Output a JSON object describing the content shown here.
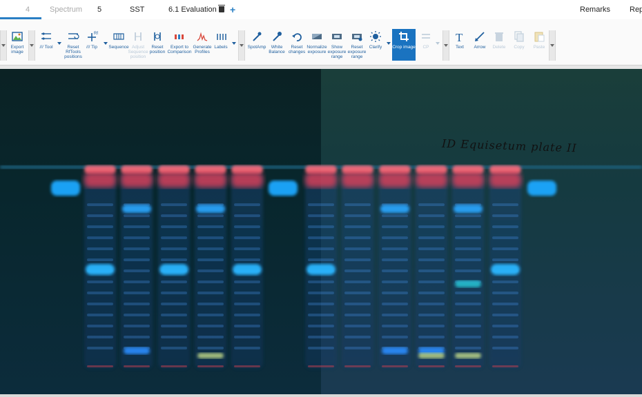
{
  "tabs": [
    {
      "label": "4",
      "dim": true
    },
    {
      "label": "Spectrum",
      "dim": true
    },
    {
      "label": "5",
      "dim": false
    },
    {
      "label": "SST",
      "dim": false
    },
    {
      "label": "6.1 Evaluation",
      "dim": false
    }
  ],
  "add_tab_label": "+",
  "right_tabs": [
    {
      "label": "Remarks"
    },
    {
      "label": "Rep"
    }
  ],
  "toolbar": {
    "export_image": "Export image",
    "tool": "/// Tool",
    "reset_rftools": "Reset RfTools positions",
    "tip": "/// Tip",
    "sequence": "Sequence",
    "adjust_sequence": "Adjust Sequence position",
    "reset_position": "Reset position",
    "export_comparison": "Export to Comparison",
    "generate_profiles": "Generate Profiles",
    "labels": "Labels",
    "spotamp": "SpotAmp",
    "white_balance": "White Balance",
    "reset_changes": "Reset changes",
    "normalize_exposure": "Normalize exposure",
    "show_exposure_range": "Show exposure range",
    "reset_exposure_range": "Reset exposure range",
    "clarify": "Clarify",
    "crop_image": "Crop image",
    "cp": "CP",
    "text": "Text",
    "arrow": "Arrow",
    "delete": "Delete",
    "copy": "Copy",
    "paste": "Paste"
  },
  "plate": {
    "annotation": "ID  Equisetum plate II",
    "colors": {
      "background": "#0a2a2c",
      "red_band": "#ff4a60",
      "blue_band": "#1ea8ff",
      "front_line": "#1d5e7a"
    },
    "tracks": [
      {
        "type": "reference",
        "bands": [
          "blue-top"
        ]
      },
      {
        "type": "sample",
        "bands": [
          "red",
          "blue-mid"
        ]
      },
      {
        "type": "sample",
        "bands": [
          "red",
          "blue-upper",
          "blue-low"
        ]
      },
      {
        "type": "sample",
        "bands": [
          "red",
          "blue-mid"
        ]
      },
      {
        "type": "sample",
        "bands": [
          "red",
          "blue-upper",
          "yellow-low"
        ]
      },
      {
        "type": "sample",
        "bands": [
          "red",
          "blue-mid"
        ]
      },
      {
        "type": "reference",
        "bands": [
          "blue-top"
        ]
      },
      {
        "type": "sample",
        "bands": [
          "red",
          "blue-mid"
        ]
      },
      {
        "type": "sample",
        "bands": [
          "red"
        ]
      },
      {
        "type": "sample",
        "bands": [
          "red",
          "blue-upper",
          "blue-low"
        ]
      },
      {
        "type": "sample",
        "bands": [
          "red",
          "blue-low",
          "yellow-low"
        ]
      },
      {
        "type": "sample",
        "bands": [
          "red",
          "blue-upper",
          "teal-mid",
          "yellow-low"
        ]
      },
      {
        "type": "sample",
        "bands": [
          "red",
          "blue-mid"
        ]
      },
      {
        "type": "reference",
        "bands": [
          "blue-top"
        ]
      }
    ]
  }
}
